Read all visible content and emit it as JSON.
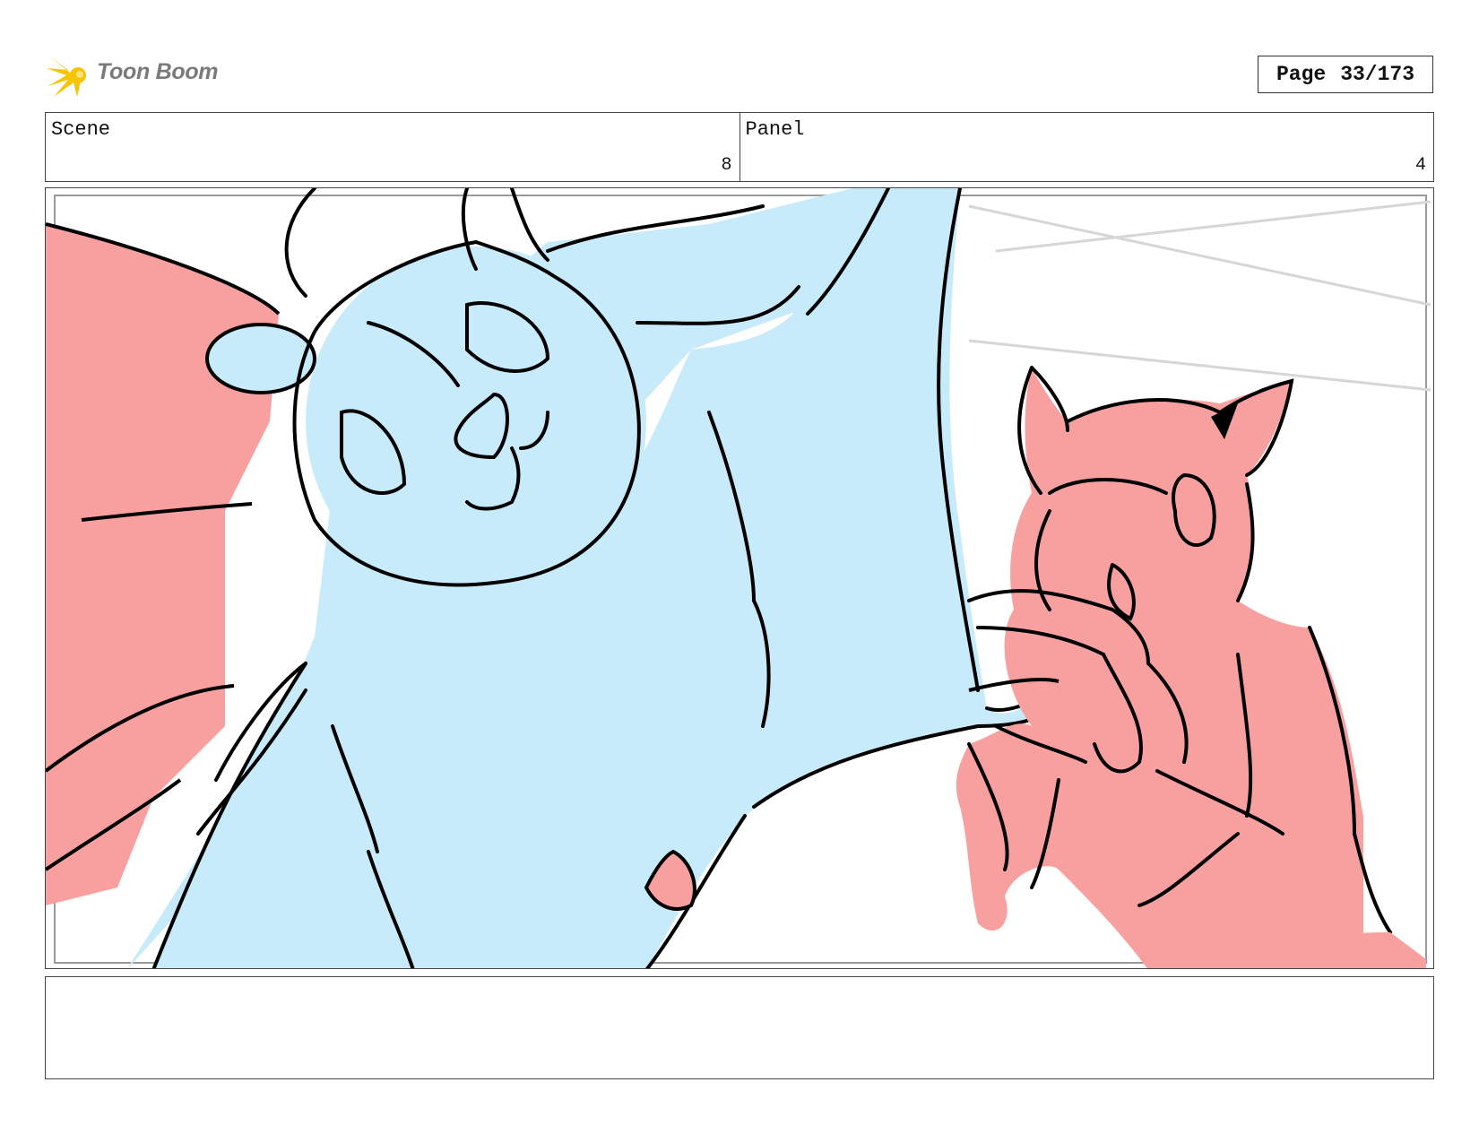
{
  "header": {
    "logo_text": "Toon Boom",
    "page_label": "Page",
    "page_value": "33/173"
  },
  "scene": {
    "label": "Scene",
    "value": "8"
  },
  "panel": {
    "label": "Panel",
    "value": "4"
  },
  "caption": {
    "text": ""
  },
  "colors": {
    "blue_fill": "#c8ebfb",
    "red_fill": "#f8a0a0",
    "line": "#000000",
    "logo_yellow": "#f6c400"
  }
}
